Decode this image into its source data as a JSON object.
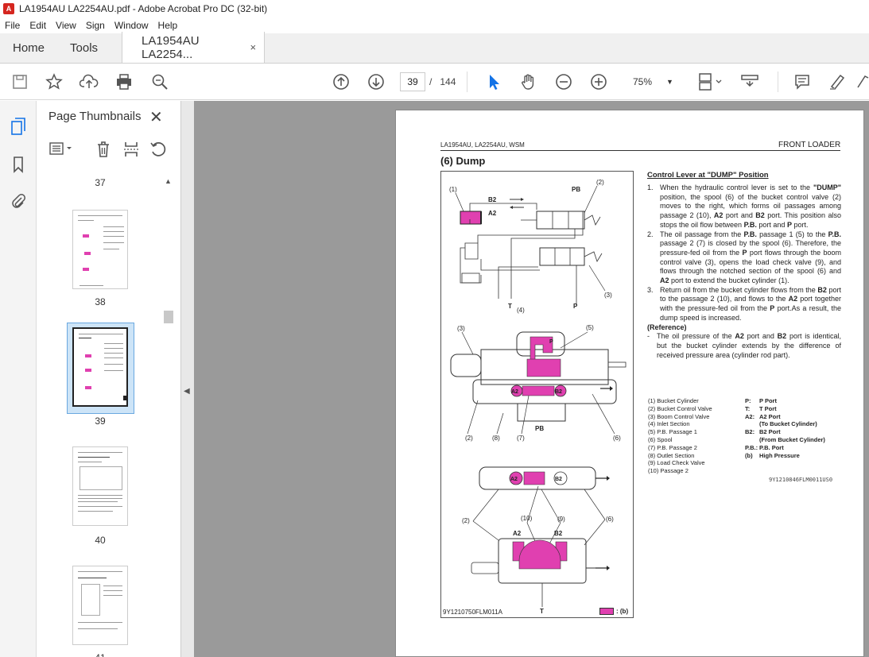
{
  "window": {
    "title": "LA1954AU LA2254AU.pdf - Adobe Acrobat Pro DC (32-bit)"
  },
  "menu": [
    "File",
    "Edit",
    "View",
    "Sign",
    "Window",
    "Help"
  ],
  "tabs": {
    "home": "Home",
    "tools": "Tools",
    "document": "LA1954AU LA2254...",
    "close": "×"
  },
  "toolbar": {
    "current_page": "39",
    "page_separator": "/",
    "total_pages": "144",
    "zoom": "75%"
  },
  "thumbnails_panel": {
    "title": "Page Thumbnails",
    "close": "✕",
    "pages": [
      {
        "label": "37"
      },
      {
        "label": "38"
      },
      {
        "label": "39",
        "selected": true
      },
      {
        "label": "40"
      },
      {
        "label": "41"
      }
    ]
  },
  "document_page": {
    "header_left": "LA1954AU, LA2254AU, WSM",
    "header_right": "FRONT LOADER",
    "section_title": "(6)   Dump",
    "right_title": "Control Lever at \"DUMP\" Position",
    "steps": [
      {
        "num": "1.",
        "text_parts": [
          "When the hydraulic control lever is set to the ",
          "\"DUMP\"",
          " position, the spool (6) of the bucket control valve (2) moves to the right, which forms oil passages among passage 2 (10), ",
          "A2",
          " port and ",
          "B2",
          " port. This position also stops the oil flow between ",
          "P.B.",
          " port and ",
          "P",
          " port."
        ]
      },
      {
        "num": "2.",
        "text_parts": [
          "The oil passage from the ",
          "P.B.",
          " passage 1 (5) to the ",
          "P.B.",
          " passage 2 (7) is closed by the spool (6). Therefore, the pressure-fed oil from the ",
          "P",
          " port flows through the boom control valve (3), opens the load check valve (9), and flows through the notched section of the spool (6) and ",
          "A2",
          " port to extend the bucket cylinder (1)."
        ]
      },
      {
        "num": "3.",
        "text_parts": [
          "Return oil from the bucket cylinder flows from the ",
          "B2",
          " port to the passage 2 (10), and flows to the ",
          "A2",
          " port together with the pressure-fed oil from the ",
          "P",
          " port.As a result, the dump speed is increased."
        ]
      }
    ],
    "reference_title": "(Reference)",
    "reference_text_parts": [
      "The oil pressure of the ",
      "A2",
      " port and ",
      "B2",
      " port is identical, but the bucket cylinder extends by the difference of received pressure area (cylinder rod part)."
    ],
    "parts_list": [
      "(1)   Bucket Cylinder",
      "(2)   Bucket Control Valve",
      "(3)   Boom Control Valve",
      "(4)   Inlet Section",
      "(5)   P.B. Passage 1",
      "(6)   Spool",
      "(7)   P.B. Passage 2",
      "(8)   Outlet Section",
      "(9)   Load Check Valve",
      "(10) Passage 2"
    ],
    "ports_list": [
      {
        "k": "P:",
        "v": "P Port"
      },
      {
        "k": "T:",
        "v": "T Port"
      },
      {
        "k": "A2:",
        "v": "A2 Port"
      },
      {
        "k": "",
        "v": "(To Bucket Cylinder)"
      },
      {
        "k": "B2:",
        "v": "B2 Port"
      },
      {
        "k": "",
        "v": "(From Bucket Cylinder)"
      },
      {
        "k": "P.B.:",
        "v": "P.B. Port"
      },
      {
        "k": "(b)",
        "v": "High Pressure"
      }
    ],
    "code_right": "9Y1210846FLM0011US0",
    "figure_caption": "9Y1210750FLM011A",
    "legend": ": (b)",
    "fig_labels": {
      "l1": "(1)",
      "l2": "(2)",
      "l3": "(3)",
      "l4": "(4)",
      "l5": "(5)",
      "l6": "(6)",
      "l7": "(7)",
      "l8": "(8)",
      "l9": "(9)",
      "l10": "(10)",
      "pb": "PB",
      "b2": "B2",
      "a2": "A2",
      "t": "T",
      "p": "P"
    },
    "colors": {
      "high_pressure": "#e040b0"
    }
  }
}
